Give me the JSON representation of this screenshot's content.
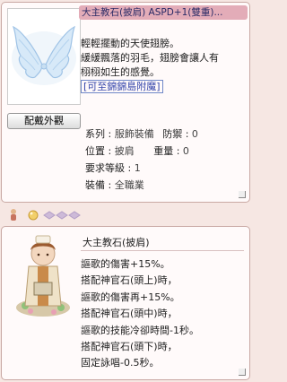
{
  "top_window": {
    "title": "大主教石(披肩) ASPD+1(雙重)...",
    "look_button": "配戴外觀",
    "description_lines": [
      "輕輕擺動的天使翅膀。",
      "緩緩飄落的羽毛，翅膀會讓人有",
      "栩栩如生的感覺。"
    ],
    "link_text": "[可至錦錦島附魔]",
    "stats": {
      "type_label": "系列",
      "type_value": "服飾裝備",
      "defense_label": "防禦",
      "defense_value": "0",
      "location_label": "位置",
      "location_value": "披肩",
      "weight_label": "重量",
      "weight_value": "0",
      "level_label": "要求等級",
      "level_value": "1",
      "equip_label": "裝備",
      "equip_value": "全職業"
    },
    "item_image_icon": "angel-wings-icon"
  },
  "slot_strip": {
    "icons": [
      "doll-icon",
      "orb-icon",
      "card-slot-icon",
      "card-slot-icon",
      "card-slot-icon"
    ]
  },
  "bottom_window": {
    "title": "大主教石(披肩)",
    "description_lines": [
      "謳歌的傷害+15%。",
      "搭配神官石(頭上)時，",
      "謳歌的傷害再+15%。",
      "搭配神官石(頭中)時，",
      "謳歌的技能冷卻時間-1秒。",
      "搭配神官石(頭下)時，",
      "固定詠唱-0.5秒。"
    ],
    "item_image_icon": "archbishop-figure-icon"
  }
}
